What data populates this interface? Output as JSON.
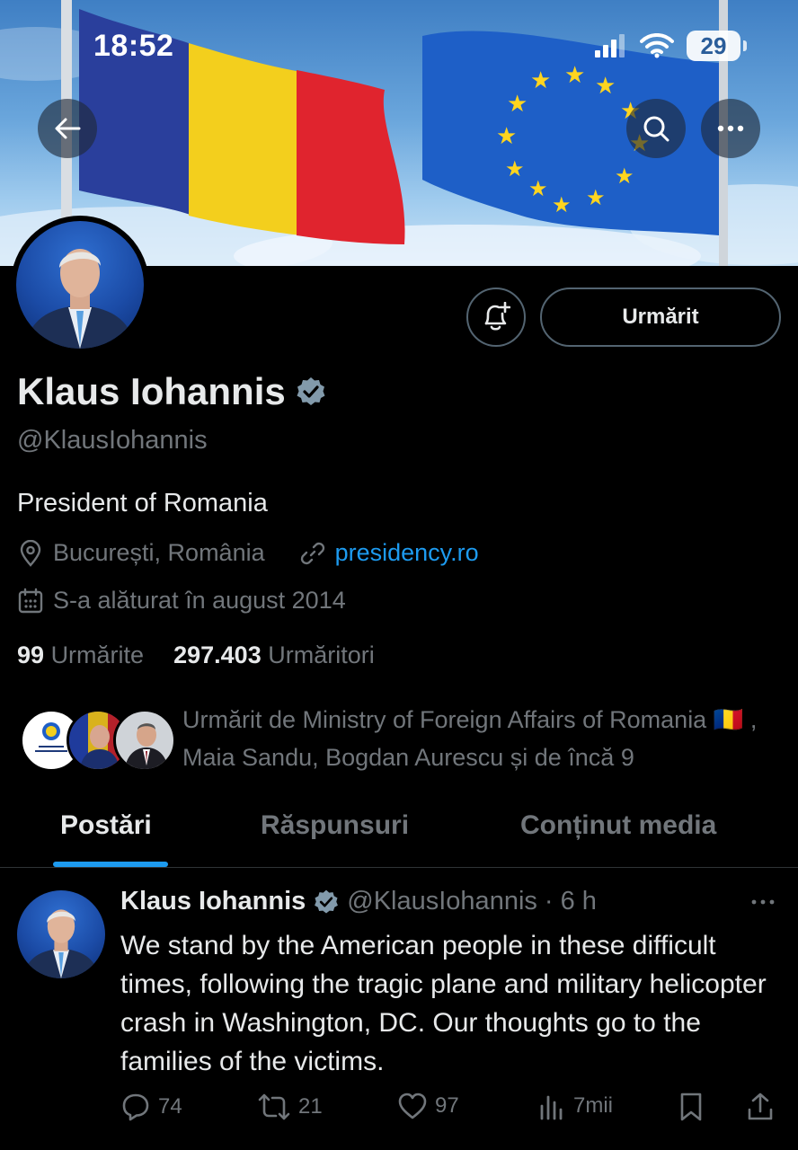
{
  "status_bar": {
    "time": "18:52",
    "battery": "29"
  },
  "profile": {
    "name": "Klaus Iohannis",
    "handle": "@KlausIohannis",
    "bio": "President of Romania",
    "location": "București, România",
    "website": "presidency.ro",
    "joined": "S-a alăturat în august 2014",
    "following_count": "99",
    "following_label": "Urmărite",
    "followers_count": "297.403",
    "followers_label": "Urmăritori",
    "follow_button_label": "Urmărit",
    "followed_by_text": "Urmărit de Ministry of Foreign Affairs of Romania 🇷🇴 , Maia Sandu, Bogdan Aurescu și de încă 9"
  },
  "tabs": [
    {
      "label": "Postări",
      "active": true
    },
    {
      "label": "Răspunsuri",
      "active": false
    },
    {
      "label": "Conținut media",
      "active": false
    }
  ],
  "post": {
    "author_name": "Klaus Iohannis",
    "author_handle": "@KlausIohannis",
    "time": "· 6 h",
    "text": "We stand by the American people in these difficult times, following the tragic plane and military helicopter crash in Washington, DC. Our thoughts go to the families of the victims.",
    "replies": "74",
    "reposts": "21",
    "likes": "97",
    "views": "7mii"
  },
  "colors": {
    "accent": "#1d9bf0",
    "verified_badge": "#829aab",
    "muted_text": "#71767b",
    "background": "#000000"
  },
  "icons": [
    "back-arrow-icon",
    "search-icon",
    "more-icon",
    "bell-plus-icon",
    "verified-badge-icon",
    "location-icon",
    "link-icon",
    "calendar-icon",
    "reply-icon",
    "repost-icon",
    "like-icon",
    "views-icon",
    "bookmark-icon",
    "share-icon"
  ]
}
